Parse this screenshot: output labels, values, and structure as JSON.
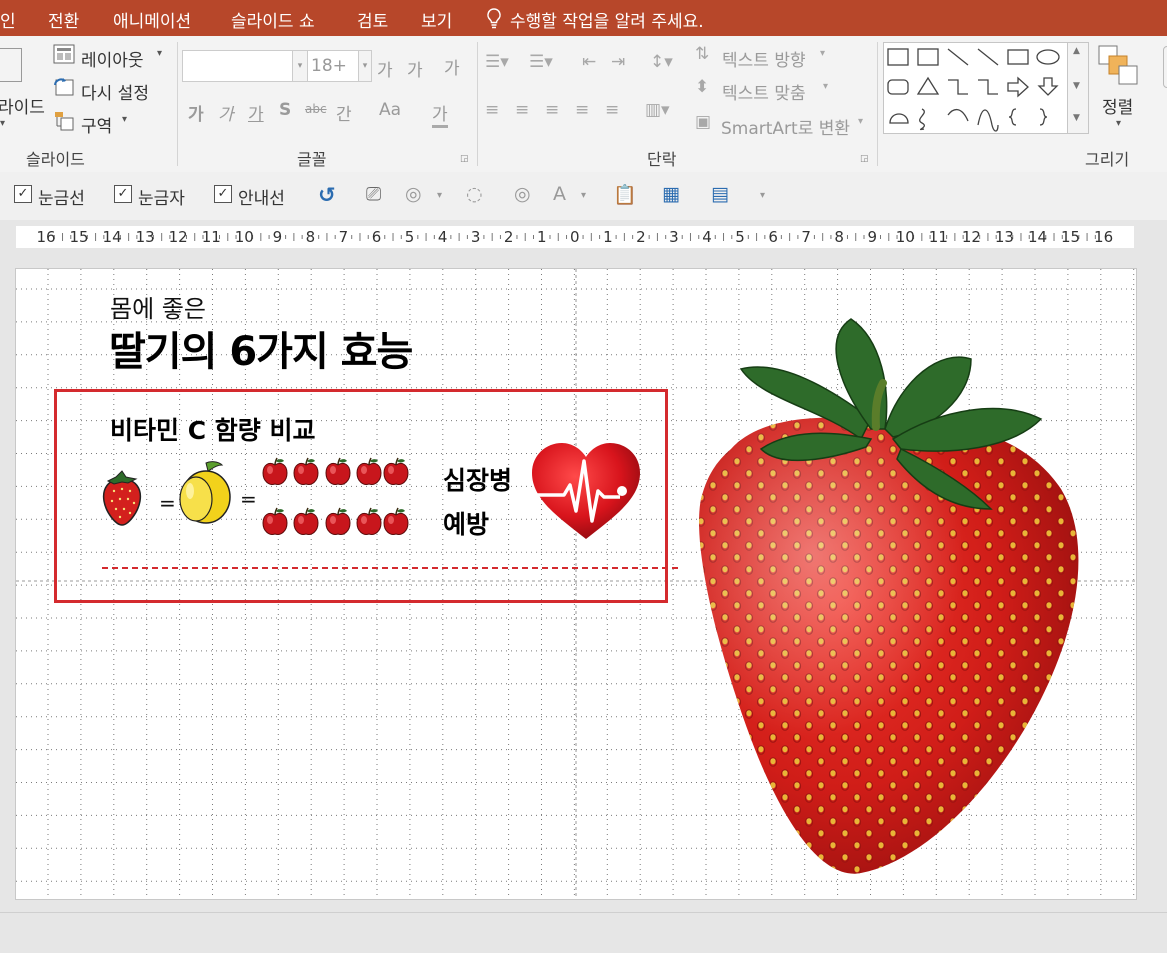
{
  "menu": {
    "items": [
      "인",
      "전환",
      "애니메이션",
      "슬라이드 쇼",
      "검토",
      "보기"
    ],
    "tell_me": "수행할 작업을 알려 주세요."
  },
  "ribbon": {
    "slides_group": {
      "layout_label": "레이아웃",
      "reset_label": "다시 설정",
      "section_label": "구역",
      "new_slide_partial": "라이드",
      "group_label": "슬라이드"
    },
    "font_group": {
      "font_size": "18+",
      "grow_font": "가",
      "shrink_font": "가",
      "clear_format": "가",
      "bold": "가",
      "italic": "가",
      "underline": "가",
      "shadow": "S",
      "strike": "abc",
      "spacing": "간",
      "change_case": "Aa",
      "font_color": "가",
      "group_label": "글꼴"
    },
    "paragraph_group": {
      "text_direction": "텍스트 방향",
      "align_text": "텍스트 맞춤",
      "smartart": "SmartArt로 변환",
      "group_label": "단락"
    },
    "drawing_group": {
      "arrange_label": "정렬",
      "group_label": "그리기"
    }
  },
  "viewbar": {
    "gridlines": "눈금선",
    "ruler": "눈금자",
    "guides": "안내선",
    "gridlines_checked": true,
    "ruler_checked": true,
    "guides_checked": true
  },
  "ruler": {
    "ticks": [
      "16",
      "15",
      "14",
      "13",
      "12",
      "11",
      "10",
      "9",
      "8",
      "7",
      "6",
      "5",
      "4",
      "3",
      "2",
      "1",
      "0",
      "1",
      "2",
      "3",
      "4",
      "5",
      "6",
      "7",
      "8",
      "9",
      "10",
      "11",
      "12",
      "13",
      "14",
      "15",
      "16"
    ]
  },
  "slide": {
    "subtitle": "몸에 좋은",
    "title": "딸기의 6가지 효능",
    "vitamin_heading": "비타민 C 함량 비교",
    "equals": "=",
    "heart_line1": "심장병",
    "heart_line2": "예방"
  },
  "colors": {
    "menu_bg": "#b7472a",
    "frame_red": "#d42a2e",
    "heart_red": "#d8141c",
    "strawberry_red": "#d3201d",
    "lemon_yellow": "#f2d21b",
    "apple_red": "#c8161c",
    "leaf_green": "#2e6b2a"
  }
}
